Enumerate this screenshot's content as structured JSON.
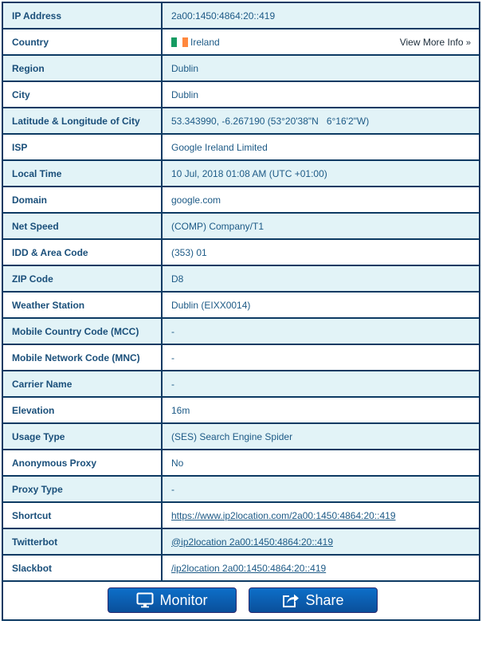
{
  "rows": [
    {
      "label": "IP Address",
      "value": "2a00:1450:4864:20::419"
    },
    {
      "label": "Country",
      "value": "Ireland",
      "link": "View More Info",
      "link_suffix": "»"
    },
    {
      "label": "Region",
      "value": "Dublin"
    },
    {
      "label": "City",
      "value": "Dublin"
    },
    {
      "label": "Latitude & Longitude of City",
      "value": "53.343990, -6.267190 (53°20'38\"N   6°16'2\"W)"
    },
    {
      "label": "ISP",
      "value": "Google Ireland Limited"
    },
    {
      "label": "Local Time",
      "value": "10 Jul, 2018 01:08 AM (UTC +01:00)"
    },
    {
      "label": "Domain",
      "value": "google.com"
    },
    {
      "label": "Net Speed",
      "value": "(COMP) Company/T1"
    },
    {
      "label": "IDD & Area Code",
      "value": "(353) 01"
    },
    {
      "label": "ZIP Code",
      "value": "D8"
    },
    {
      "label": "Weather Station",
      "value": "Dublin (EIXX0014)"
    },
    {
      "label": "Mobile Country Code (MCC)",
      "value": "-"
    },
    {
      "label": "Mobile Network Code (MNC)",
      "value": "-"
    },
    {
      "label": "Carrier Name",
      "value": "-"
    },
    {
      "label": "Elevation",
      "value": "16m"
    },
    {
      "label": "Usage Type",
      "value": "(SES) Search Engine Spider"
    },
    {
      "label": "Anonymous Proxy",
      "value": "No"
    },
    {
      "label": "Proxy Type",
      "value": "-"
    },
    {
      "label": "Shortcut",
      "value": "https://www.ip2location.com/2a00:1450:4864:20::419"
    },
    {
      "label": "Twitterbot",
      "value": "@ip2location 2a00:1450:4864:20::419"
    },
    {
      "label": "Slackbot",
      "value": "/ip2location 2a00:1450:4864:20::419"
    }
  ],
  "flag_colors": [
    "#169b62",
    "#ffffff",
    "#ff883e"
  ],
  "buttons": {
    "monitor": "Monitor",
    "share": "Share"
  }
}
